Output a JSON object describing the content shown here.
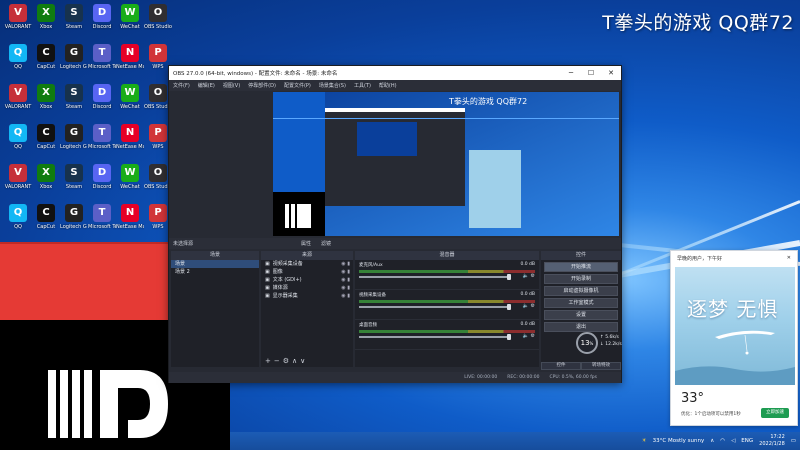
{
  "overlay": {
    "title": "T拳头的游戏 QQ群72"
  },
  "desktop_icons": [
    {
      "label": "VALORANT",
      "icon": "valorant-icon",
      "color": "#c62f3a",
      "glyph": "V"
    },
    {
      "label": "Xbox",
      "icon": "xbox-icon",
      "color": "#107c10",
      "glyph": "X"
    },
    {
      "label": "Steam",
      "icon": "steam-icon",
      "color": "#17324d",
      "glyph": "S"
    },
    {
      "label": "Discord",
      "icon": "discord-icon",
      "color": "#5865f2",
      "glyph": "D"
    },
    {
      "label": "WeChat",
      "icon": "wechat-icon",
      "color": "#1aad19",
      "glyph": "W"
    },
    {
      "label": "OBS Studio",
      "icon": "obs-icon",
      "color": "#302e31",
      "glyph": "O"
    },
    {
      "label": "QQ",
      "icon": "qq-icon",
      "color": "#12b7f5",
      "glyph": "Q"
    },
    {
      "label": "CapCut",
      "icon": "capcut-icon",
      "color": "#111111",
      "glyph": "C"
    },
    {
      "label": "Logitech G HUB",
      "icon": "logitech-icon",
      "color": "#222222",
      "glyph": "G"
    },
    {
      "label": "Microsoft Teams",
      "icon": "teams-icon",
      "color": "#5b5fc7",
      "glyph": "T"
    },
    {
      "label": "NetEase Music",
      "icon": "netease-music-icon",
      "color": "#e60026",
      "glyph": "N"
    },
    {
      "label": "WPS",
      "icon": "wps-icon",
      "color": "#d13438",
      "glyph": "P"
    }
  ],
  "obs": {
    "title": "OBS 27.0.0 (64-bit, windows) - 配置文件: 未命名 - 场景: 未命名",
    "menu": [
      "文件(F)",
      "编辑(E)",
      "视图(V)",
      "停靠部件(D)",
      "配置文件(P)",
      "场景集合(S)",
      "工具(T)",
      "帮助(H)"
    ],
    "preview_status": [
      "未选择源",
      "属性",
      "滤镜"
    ],
    "docks": {
      "scenes_title": "场景",
      "sources_title": "来源",
      "mixer_title": "混音器",
      "controls_title": "控件"
    },
    "scenes": [
      "场景",
      "场景 2"
    ],
    "sources": [
      "视频采集设备",
      "图像",
      "文本 (GDI+)",
      "媒体源",
      "显示器采集"
    ],
    "mixer": [
      {
        "name": "麦克风/Aux",
        "db": "0.0 dB"
      },
      {
        "name": "视频采集设备",
        "db": "0.0 dB"
      },
      {
        "name": "桌面音频",
        "db": "0.0 dB"
      }
    ],
    "controls": [
      "开始推流",
      "开始录制",
      "启动虚拟摄像机",
      "工作室模式",
      "设置",
      "退出"
    ],
    "tabs": [
      "控件",
      "转场特效"
    ],
    "status": [
      "LIVE: 00:00:00",
      "REC: 00:00:00",
      "CPU: 0.5%, 60.00 fps"
    ]
  },
  "perf": {
    "value": "13",
    "unit": "%",
    "up": "5.6k/s",
    "down": "12.2k/s"
  },
  "weather": {
    "greeting": "早晚的用户，下午好",
    "slogan": "逐梦 无惧",
    "temp": "33°",
    "desc": "优化：1个启动项可以禁用1秒",
    "button": "立即加速"
  },
  "taskbar": {
    "weather_text": "33°C  Mostly sunny",
    "lang": "ENG",
    "time": "17:22",
    "date": "2022/1/28"
  },
  "colors": {
    "overlay_red": "#e53a35",
    "obs_bg": "#272a33",
    "taskbar": "#164d9c"
  }
}
